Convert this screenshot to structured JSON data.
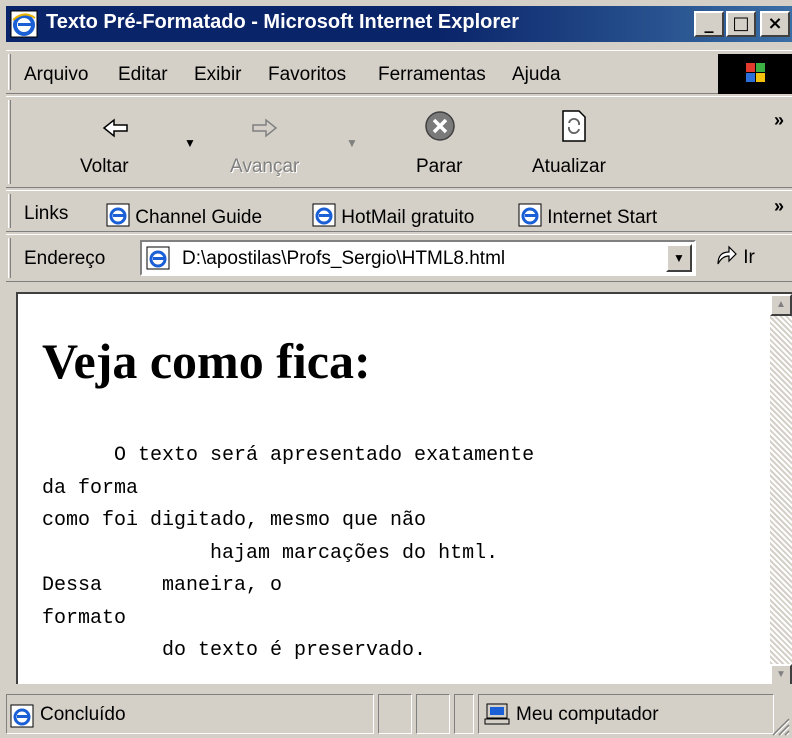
{
  "window": {
    "title": "Texto Pré-Formatado - Microsoft Internet Explorer",
    "controls": {
      "minimize": "_",
      "maximize": "□",
      "close": "×"
    }
  },
  "menu": {
    "items": [
      "Arquivo",
      "Editar",
      "Exibir",
      "Favoritos",
      "Ferramentas",
      "Ajuda"
    ]
  },
  "toolbar": {
    "back_label": "Voltar",
    "forward_label": "Avançar",
    "stop_label": "Parar",
    "refresh_label": "Atualizar",
    "more": "»"
  },
  "links_bar": {
    "label": "Links",
    "items": [
      "Channel Guide",
      "HotMail gratuito",
      "Internet Start"
    ],
    "more": "»"
  },
  "address_bar": {
    "label": "Endereço",
    "value": "D:\\apostilas\\Profs_Sergio\\HTML8.html",
    "go_label": "Ir"
  },
  "page": {
    "heading": "Veja como fica:",
    "preformatted": "      O texto será apresentado exatamente\nda forma\ncomo foi digitado, mesmo que não\n              hajam marcações do html.\nDessa     maneira, o\nformato\n          do texto é preservado."
  },
  "status_bar": {
    "status": "Concluído",
    "zone": "Meu computador"
  },
  "icons": {
    "ie": "ie-logo-icon",
    "back": "back-arrow-icon",
    "forward": "forward-arrow-icon",
    "stop": "stop-icon",
    "refresh": "refresh-icon",
    "go": "go-arrow-icon",
    "computer": "computer-icon"
  },
  "colors": {
    "title_bar": "#0a246a",
    "chrome": "#d4d0c8",
    "content_bg": "#ffffff"
  }
}
